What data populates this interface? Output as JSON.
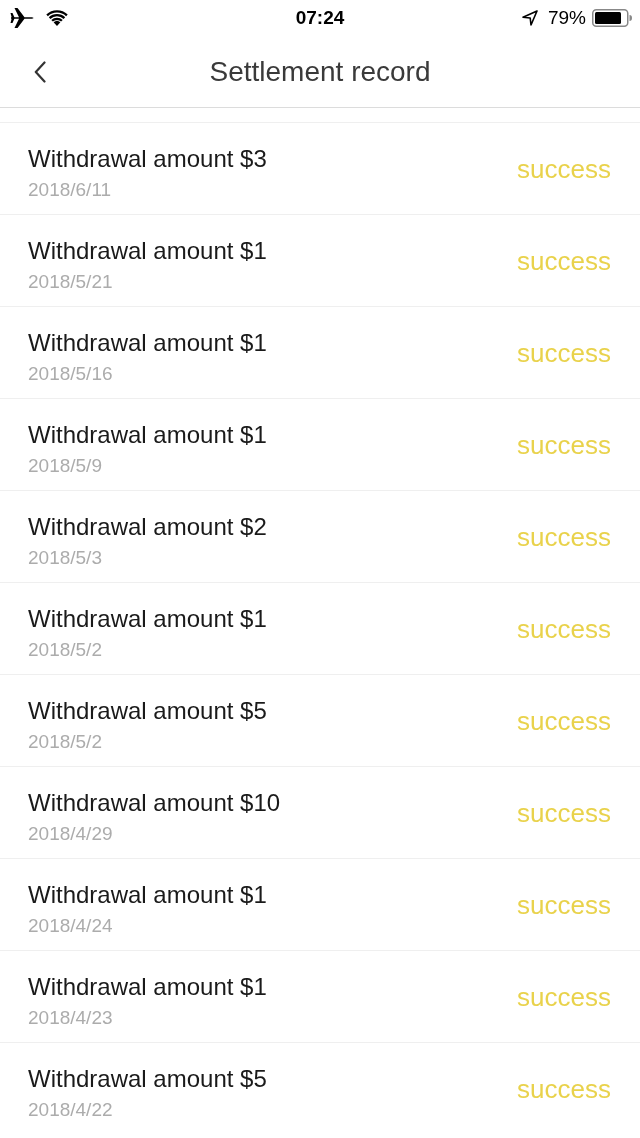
{
  "status_bar": {
    "time": "07:24",
    "battery": "79%"
  },
  "nav": {
    "title": "Settlement record"
  },
  "records": [
    {
      "title": "Withdrawal amount $3",
      "date": "2018/6/11",
      "status": "success"
    },
    {
      "title": "Withdrawal amount $1",
      "date": "2018/5/21",
      "status": "success"
    },
    {
      "title": "Withdrawal amount $1",
      "date": "2018/5/16",
      "status": "success"
    },
    {
      "title": "Withdrawal amount $1",
      "date": "2018/5/9",
      "status": "success"
    },
    {
      "title": "Withdrawal amount $2",
      "date": "2018/5/3",
      "status": "success"
    },
    {
      "title": "Withdrawal amount $1",
      "date": "2018/5/2",
      "status": "success"
    },
    {
      "title": "Withdrawal amount $5",
      "date": "2018/5/2",
      "status": "success"
    },
    {
      "title": "Withdrawal amount $10",
      "date": "2018/4/29",
      "status": "success"
    },
    {
      "title": "Withdrawal amount $1",
      "date": "2018/4/24",
      "status": "success"
    },
    {
      "title": "Withdrawal amount $1",
      "date": "2018/4/23",
      "status": "success"
    },
    {
      "title": "Withdrawal amount $5",
      "date": "2018/4/22",
      "status": "success"
    }
  ]
}
